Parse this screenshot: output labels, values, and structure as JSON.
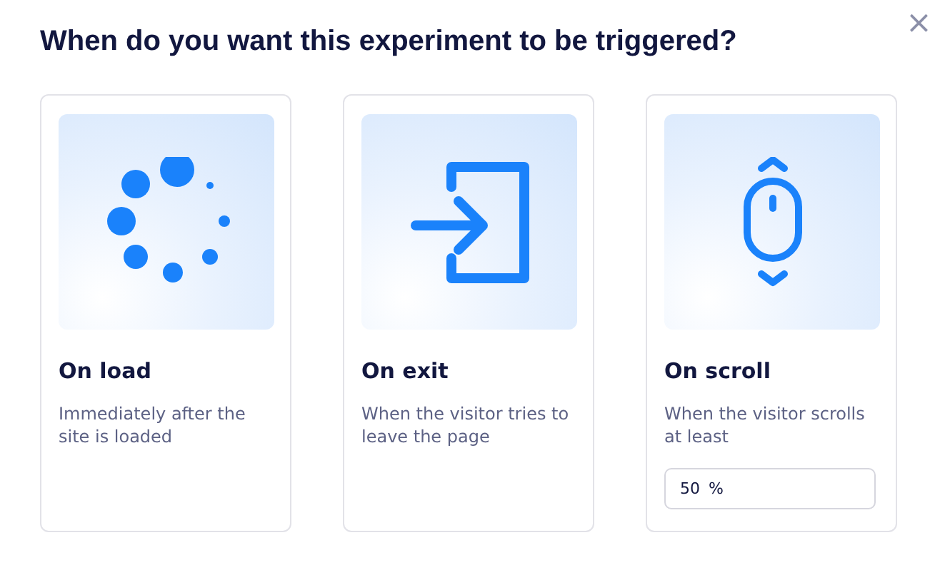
{
  "dialog": {
    "title": "When do you want this experiment to be triggered?",
    "close": "×"
  },
  "options": [
    {
      "kind": "load",
      "title": "On load",
      "description": "Immediately after the site is loaded"
    },
    {
      "kind": "exit",
      "title": "On exit",
      "description": "When the visitor tries to leave the page"
    },
    {
      "kind": "scroll",
      "title": "On scroll",
      "description": "When the visitor scrolls at least",
      "field": {
        "value": "50",
        "unit": "%"
      }
    }
  ]
}
